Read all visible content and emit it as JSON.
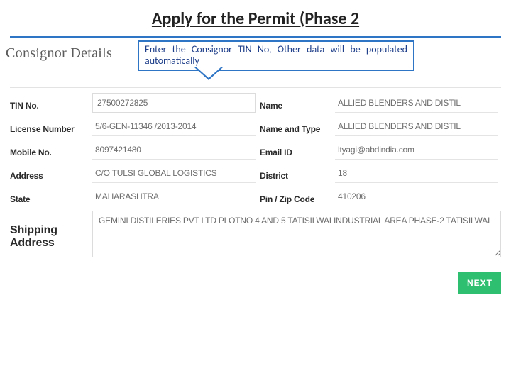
{
  "header": {
    "title": "Apply for the Permit (Phase 2"
  },
  "section": {
    "title": "Consignor Details"
  },
  "callout": {
    "text": "Enter the Consignor TIN No, Other data will be populated automatically"
  },
  "fields": {
    "tin_no": {
      "label": "TIN No.",
      "value": "27500272825"
    },
    "name": {
      "label": "Name",
      "value": "ALLIED BLENDERS  AND DISTIL"
    },
    "license_number": {
      "label": "License Number",
      "value": "5/6-GEN-11346 /2013-2014"
    },
    "name_type": {
      "label": "Name and Type",
      "value": "ALLIED BLENDERS  AND DISTIL"
    },
    "mobile": {
      "label": "Mobile No.",
      "value": "8097421480"
    },
    "email": {
      "label": "Email ID",
      "value": "ltyagi@abdindia.com"
    },
    "address": {
      "label": "Address",
      "value": "C/O TULSI GLOBAL  LOGISTICS"
    },
    "district": {
      "label": "District",
      "value": "18"
    },
    "state": {
      "label": "State",
      "value": "MAHARASHTRA"
    },
    "pin": {
      "label": "Pin / Zip Code",
      "value": "410206"
    },
    "shipping": {
      "label": "Shipping Address",
      "value": "GEMINI DISTILERIES PVT LTD PLOTNO 4 AND 5 TATISILWAI INDUSTRIAL AREA PHASE-2 TATISILWAI"
    }
  },
  "actions": {
    "next": "NEXT"
  }
}
